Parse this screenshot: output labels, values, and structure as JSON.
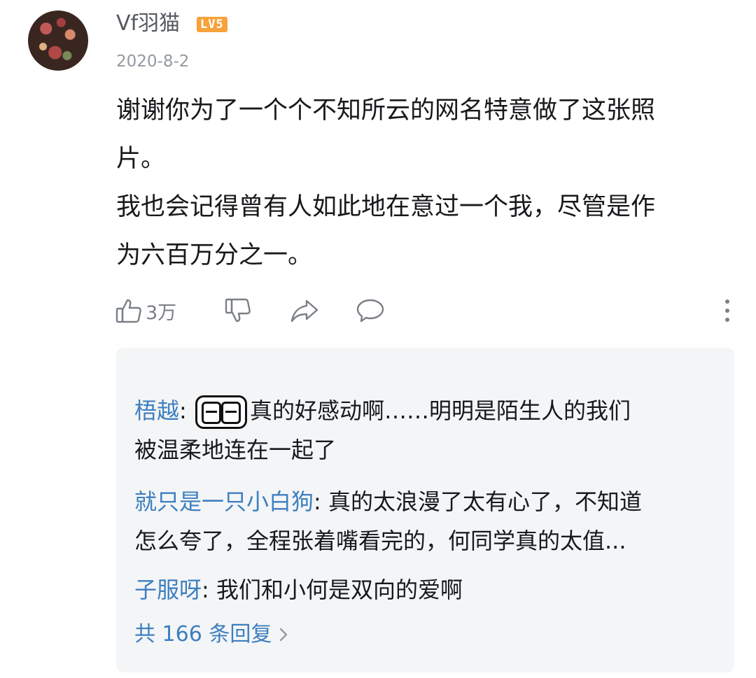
{
  "comment": {
    "username": "Vf羽猫",
    "level": "LV5",
    "date": "2020-8-2",
    "lines": [
      "谢谢你为了一个个不知所云的网名特意做了这张照",
      "片。",
      "我也会记得曾有人如此地在意过一个我，尽管是作",
      "为六百万分之一。"
    ],
    "like_count": "3万"
  },
  "icons": {
    "like": "thumbs-up-icon",
    "dislike": "thumbs-down-icon",
    "share": "share-icon",
    "reply": "chat-bubble-icon",
    "more": "more-vertical-icon"
  },
  "replies": [
    {
      "author": "梧越",
      "emoji": "tear-emoji",
      "line1": "真的好感动啊……明明是陌生人的我们",
      "line2": "被温柔地连在一起了"
    },
    {
      "author": "就只是一只小白狗",
      "line1": "真的太浪漫了太有心了，不知道",
      "line2": "怎么夸了，全程张着嘴看完的，何同学真的太值..."
    },
    {
      "author": "子服呀",
      "line1": "我们和小何是双向的爱啊"
    }
  ],
  "total_replies": "共 166 条回复",
  "colors": {
    "link_blue": "#3c7fbf",
    "badge_orange": "#f7a23a",
    "reply_bg": "#f4f5f7"
  }
}
